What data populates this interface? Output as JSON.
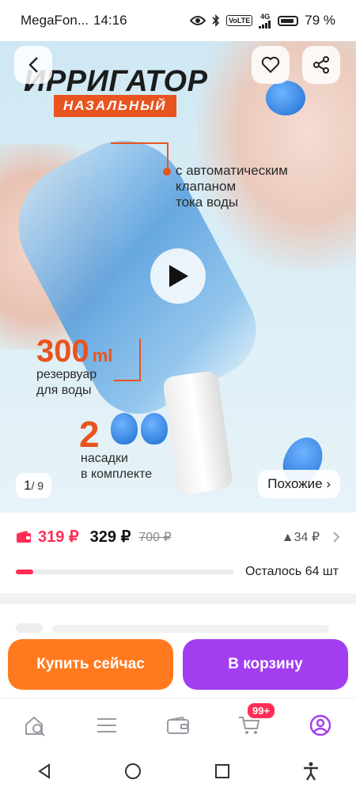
{
  "status_bar": {
    "carrier": "MegaFon...",
    "time": "14:16",
    "volte": "VoLTE",
    "network": "4G",
    "battery": "79 %"
  },
  "hero": {
    "title": "ИРРИГАТОР",
    "subtitle": "НАЗАЛЬНЫЙ",
    "feature_valve": "с автоматическим\nклапаном\nтока воды",
    "reservoir_value": "300",
    "reservoir_unit": "ml",
    "reservoir_text": "резервуар\nдля воды",
    "nozzles_value": "2",
    "nozzles_text": "насадки\nв комплекте",
    "counter_current": "1",
    "counter_total": "/ 9",
    "similar_label": "Похожие ›"
  },
  "price": {
    "wallet_price": "319 ₽",
    "price": "329 ₽",
    "old_price": "700 ₽",
    "rating_delta": "▲34 ₽",
    "stock_fraction": 0.08,
    "stock_label": "Осталось 64 шт"
  },
  "actions": {
    "buy_now": "Купить сейчас",
    "add_to_cart": "В корзину"
  },
  "tabbar": {
    "cart_badge": "99+"
  },
  "colors": {
    "accent_orange": "#ff7a1f",
    "accent_purple": "#a23df0",
    "price_red": "#ff2d55",
    "brand_orange": "#e8541e"
  }
}
